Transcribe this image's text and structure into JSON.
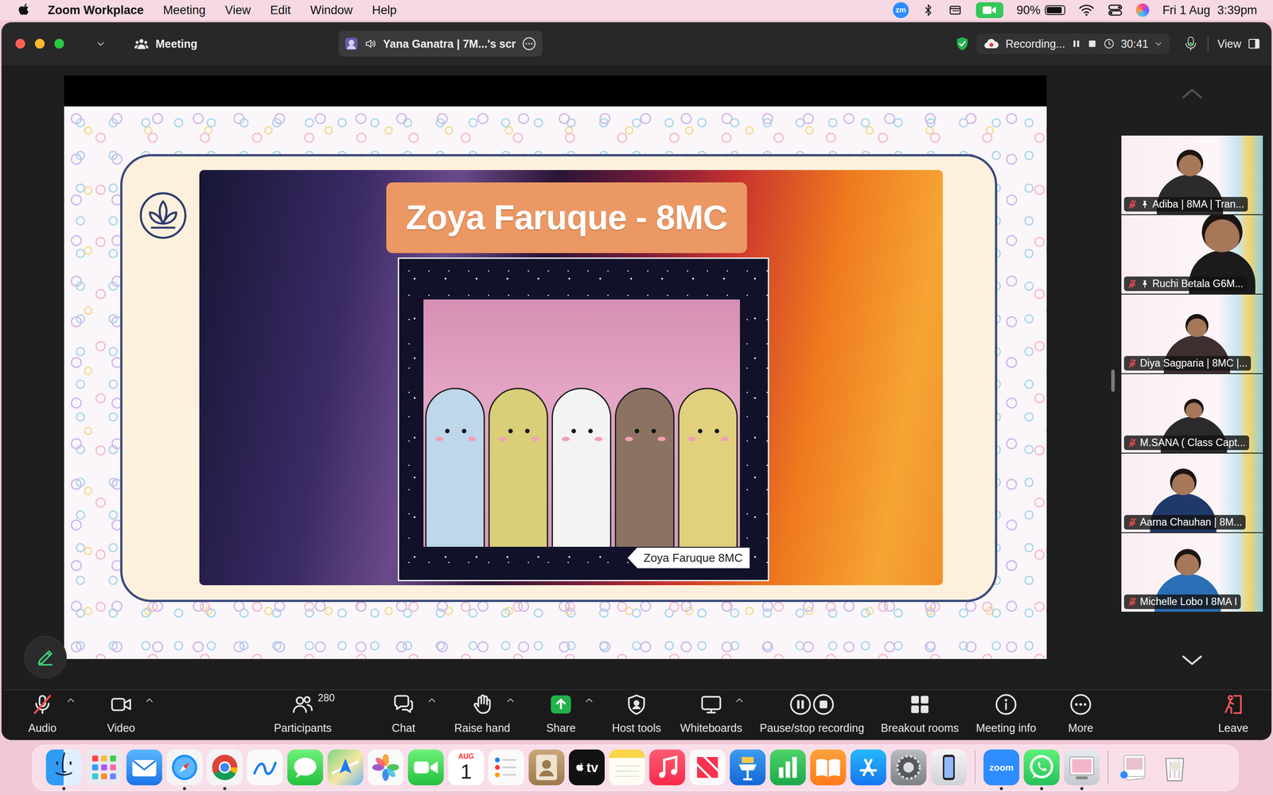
{
  "menubar": {
    "app_name": "Zoom Workplace",
    "menus": [
      "Meeting",
      "View",
      "Edit",
      "Window",
      "Help"
    ],
    "zoom_badge": "zm",
    "battery": {
      "reading": "90%",
      "level": 0.9
    },
    "date": "Fri 1 Aug",
    "time": "3:39pm"
  },
  "window": {
    "title": "Meeting",
    "tab": {
      "label": "Yana Ganatra | 7M...'s scr"
    },
    "recording": {
      "label": "Recording...",
      "timer": "30:41"
    },
    "mic": {
      "level": 0.35
    },
    "view_button": "View"
  },
  "slide": {
    "title": "Zoya Faruque - 8MC",
    "artwork_tag": "Zoya Faruque 8MC"
  },
  "video_tiles": [
    {
      "name": "Adiba | 8MA | Tran...",
      "muted": true,
      "pinned": true
    },
    {
      "name": "Ruchi Betala G6M...",
      "muted": true,
      "pinned": true
    },
    {
      "name": "Diya Sagparia | 8MC |...",
      "muted": true,
      "pinned": false
    },
    {
      "name": "M.SANA ( Class Capt...",
      "muted": true,
      "pinned": false
    },
    {
      "name": "Aarna Chauhan | 8M...",
      "muted": true,
      "pinned": false
    },
    {
      "name": "Michelle Lobo I 8MA I",
      "muted": true,
      "pinned": false
    }
  ],
  "toolbar": [
    {
      "label": "Audio",
      "kind": "audio",
      "muted": true,
      "has_menu": true
    },
    {
      "label": "Video",
      "kind": "video",
      "has_menu": true
    },
    {
      "label": "Participants",
      "kind": "participants",
      "count": "280",
      "has_menu": false
    },
    {
      "label": "Chat",
      "kind": "chat",
      "has_menu": true
    },
    {
      "label": "Raise hand",
      "kind": "raise-hand",
      "has_menu": true
    },
    {
      "label": "Share",
      "kind": "share",
      "has_menu": true
    },
    {
      "label": "Host tools",
      "kind": "host-tools",
      "has_menu": false
    },
    {
      "label": "Whiteboards",
      "kind": "whiteboards",
      "has_menu": true
    },
    {
      "label": "Pause/stop recording",
      "kind": "recording",
      "has_menu": false
    },
    {
      "label": "Breakout rooms",
      "kind": "breakout",
      "has_menu": false
    },
    {
      "label": "Meeting info",
      "kind": "info",
      "has_menu": false
    },
    {
      "label": "More",
      "kind": "more",
      "has_menu": false
    },
    {
      "label": "Leave",
      "kind": "leave",
      "has_menu": false
    }
  ],
  "dock": [
    {
      "kind": "finder",
      "running": true
    },
    {
      "kind": "launchpad",
      "running": false
    },
    {
      "kind": "mail",
      "running": false
    },
    {
      "kind": "safari",
      "running": true
    },
    {
      "kind": "chrome",
      "running": true
    },
    {
      "kind": "freeform",
      "running": false
    },
    {
      "kind": "messages",
      "running": false
    },
    {
      "kind": "maps",
      "running": false
    },
    {
      "kind": "photos",
      "running": false
    },
    {
      "kind": "facetime",
      "running": false
    },
    {
      "kind": "calendar",
      "running": false,
      "month": "AUG",
      "day": "1"
    },
    {
      "kind": "reminders",
      "running": false
    },
    {
      "kind": "contacts",
      "running": false
    },
    {
      "kind": "tv",
      "running": false,
      "label": "tv"
    },
    {
      "kind": "notes",
      "running": false
    },
    {
      "kind": "music",
      "running": false
    },
    {
      "kind": "news",
      "running": false
    },
    {
      "kind": "keynote",
      "running": false
    },
    {
      "kind": "numbers",
      "running": false
    },
    {
      "kind": "books",
      "running": false
    },
    {
      "kind": "appstore",
      "running": false
    },
    {
      "kind": "settings",
      "running": false
    },
    {
      "kind": "iphone",
      "running": false
    },
    {
      "kind": "separator"
    },
    {
      "kind": "zoom",
      "running": true,
      "label": "zoom"
    },
    {
      "kind": "whatsapp",
      "running": true
    },
    {
      "kind": "preview",
      "running": true
    },
    {
      "kind": "separator"
    },
    {
      "kind": "downloads",
      "running": false
    },
    {
      "kind": "trash",
      "running": false
    }
  ]
}
